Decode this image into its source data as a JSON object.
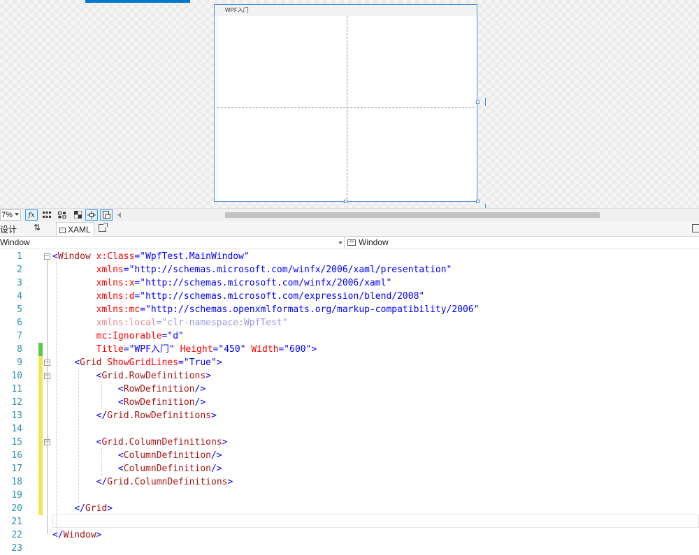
{
  "designer": {
    "window_title": "WPF入门"
  },
  "zoom_bar": {
    "zoom_level": "7%",
    "fx_label": "fx"
  },
  "tabs": {
    "design_label": "设计",
    "swap_label": "⇅",
    "xaml_label": "XAML"
  },
  "nav": {
    "left_selector": "Window",
    "right_selector": "Window"
  },
  "colors": {
    "line_number": "#2b91af",
    "markup_punctuation": "#0000ff",
    "element_name": "#a31515",
    "attribute_name": "#ff0000",
    "attribute_value": "#0000ff",
    "change_saved": "#57c94d",
    "change_unsaved": "#f0e65a"
  },
  "code_lines": [
    {
      "num": "1",
      "indent": "",
      "tokens": [
        [
          "p",
          "<"
        ],
        [
          "t",
          "Window"
        ],
        [
          "s",
          " "
        ],
        [
          "a",
          "x:Class"
        ],
        [
          "p",
          "=\""
        ],
        [
          "v",
          "WpfTest.MainWindow"
        ],
        [
          "p",
          "\""
        ]
      ]
    },
    {
      "num": "2",
      "indent": "        ",
      "tokens": [
        [
          "a",
          "xmlns"
        ],
        [
          "p",
          "=\""
        ],
        [
          "v",
          "http://schemas.microsoft.com/winfx/2006/xaml/presentation"
        ],
        [
          "p",
          "\""
        ]
      ]
    },
    {
      "num": "3",
      "indent": "        ",
      "tokens": [
        [
          "a",
          "xmlns:x"
        ],
        [
          "p",
          "=\""
        ],
        [
          "v",
          "http://schemas.microsoft.com/winfx/2006/xaml"
        ],
        [
          "p",
          "\""
        ]
      ]
    },
    {
      "num": "4",
      "indent": "        ",
      "tokens": [
        [
          "a",
          "xmlns:d"
        ],
        [
          "p",
          "=\""
        ],
        [
          "v",
          "http://schemas.microsoft.com/expression/blend/2008"
        ],
        [
          "p",
          "\""
        ]
      ]
    },
    {
      "num": "5",
      "indent": "        ",
      "tokens": [
        [
          "a",
          "xmlns:mc"
        ],
        [
          "p",
          "=\""
        ],
        [
          "v",
          "http://schemas.openxmlformats.org/markup-compatibility/2006"
        ],
        [
          "p",
          "\""
        ]
      ]
    },
    {
      "num": "6",
      "indent": "        ",
      "tokens": [
        [
          "da",
          "xmlns:local"
        ],
        [
          "dv",
          "=\"clr-namespace:WpfTest\""
        ]
      ]
    },
    {
      "num": "7",
      "indent": "        ",
      "tokens": [
        [
          "a",
          "mc:Ignorable"
        ],
        [
          "p",
          "=\""
        ],
        [
          "v",
          "d"
        ],
        [
          "p",
          "\""
        ]
      ]
    },
    {
      "num": "8",
      "indent": "        ",
      "tokens": [
        [
          "a",
          "Title"
        ],
        [
          "p",
          "=\""
        ],
        [
          "v",
          "WPF入门"
        ],
        [
          "p",
          "\""
        ],
        [
          "s",
          " "
        ],
        [
          "a",
          "Height"
        ],
        [
          "p",
          "=\""
        ],
        [
          "v",
          "450"
        ],
        [
          "p",
          "\""
        ],
        [
          "s",
          " "
        ],
        [
          "a",
          "Width"
        ],
        [
          "p",
          "=\""
        ],
        [
          "v",
          "600"
        ],
        [
          "p",
          "\">"
        ]
      ]
    },
    {
      "num": "9",
      "indent": "    ",
      "tokens": [
        [
          "p",
          "<"
        ],
        [
          "t",
          "Grid"
        ],
        [
          "s",
          " "
        ],
        [
          "a",
          "ShowGridLines"
        ],
        [
          "p",
          "=\""
        ],
        [
          "v",
          "True"
        ],
        [
          "p",
          "\">"
        ]
      ]
    },
    {
      "num": "10",
      "indent": "        ",
      "tokens": [
        [
          "p",
          "<"
        ],
        [
          "t",
          "Grid.RowDefinitions"
        ],
        [
          "p",
          ">"
        ]
      ]
    },
    {
      "num": "11",
      "indent": "            ",
      "tokens": [
        [
          "p",
          "<"
        ],
        [
          "t",
          "RowDefinition"
        ],
        [
          "p",
          "/>"
        ]
      ]
    },
    {
      "num": "12",
      "indent": "            ",
      "tokens": [
        [
          "p",
          "<"
        ],
        [
          "t",
          "RowDefinition"
        ],
        [
          "p",
          "/>"
        ]
      ]
    },
    {
      "num": "13",
      "indent": "        ",
      "tokens": [
        [
          "p",
          "</"
        ],
        [
          "t",
          "Grid.RowDefinitions"
        ],
        [
          "p",
          ">"
        ]
      ]
    },
    {
      "num": "14",
      "indent": "",
      "tokens": []
    },
    {
      "num": "15",
      "indent": "        ",
      "tokens": [
        [
          "p",
          "<"
        ],
        [
          "t",
          "Grid.ColumnDefinitions"
        ],
        [
          "p",
          ">"
        ]
      ]
    },
    {
      "num": "16",
      "indent": "            ",
      "tokens": [
        [
          "p",
          "<"
        ],
        [
          "t",
          "ColumnDefinition"
        ],
        [
          "p",
          "/>"
        ]
      ]
    },
    {
      "num": "17",
      "indent": "            ",
      "tokens": [
        [
          "p",
          "<"
        ],
        [
          "t",
          "ColumnDefinition"
        ],
        [
          "p",
          "/>"
        ]
      ]
    },
    {
      "num": "18",
      "indent": "        ",
      "tokens": [
        [
          "p",
          "</"
        ],
        [
          "t",
          "Grid.ColumnDefinitions"
        ],
        [
          "p",
          ">"
        ]
      ]
    },
    {
      "num": "19",
      "indent": "",
      "tokens": []
    },
    {
      "num": "20",
      "indent": "    ",
      "tokens": [
        [
          "p",
          "</"
        ],
        [
          "t",
          "Grid"
        ],
        [
          "p",
          ">"
        ]
      ]
    },
    {
      "num": "21",
      "indent": "",
      "tokens": []
    },
    {
      "num": "22",
      "indent": "",
      "tokens": [
        [
          "p",
          "</"
        ],
        [
          "t",
          "Window"
        ],
        [
          "p",
          ">"
        ]
      ]
    },
    {
      "num": "23",
      "indent": "",
      "tokens": []
    }
  ]
}
